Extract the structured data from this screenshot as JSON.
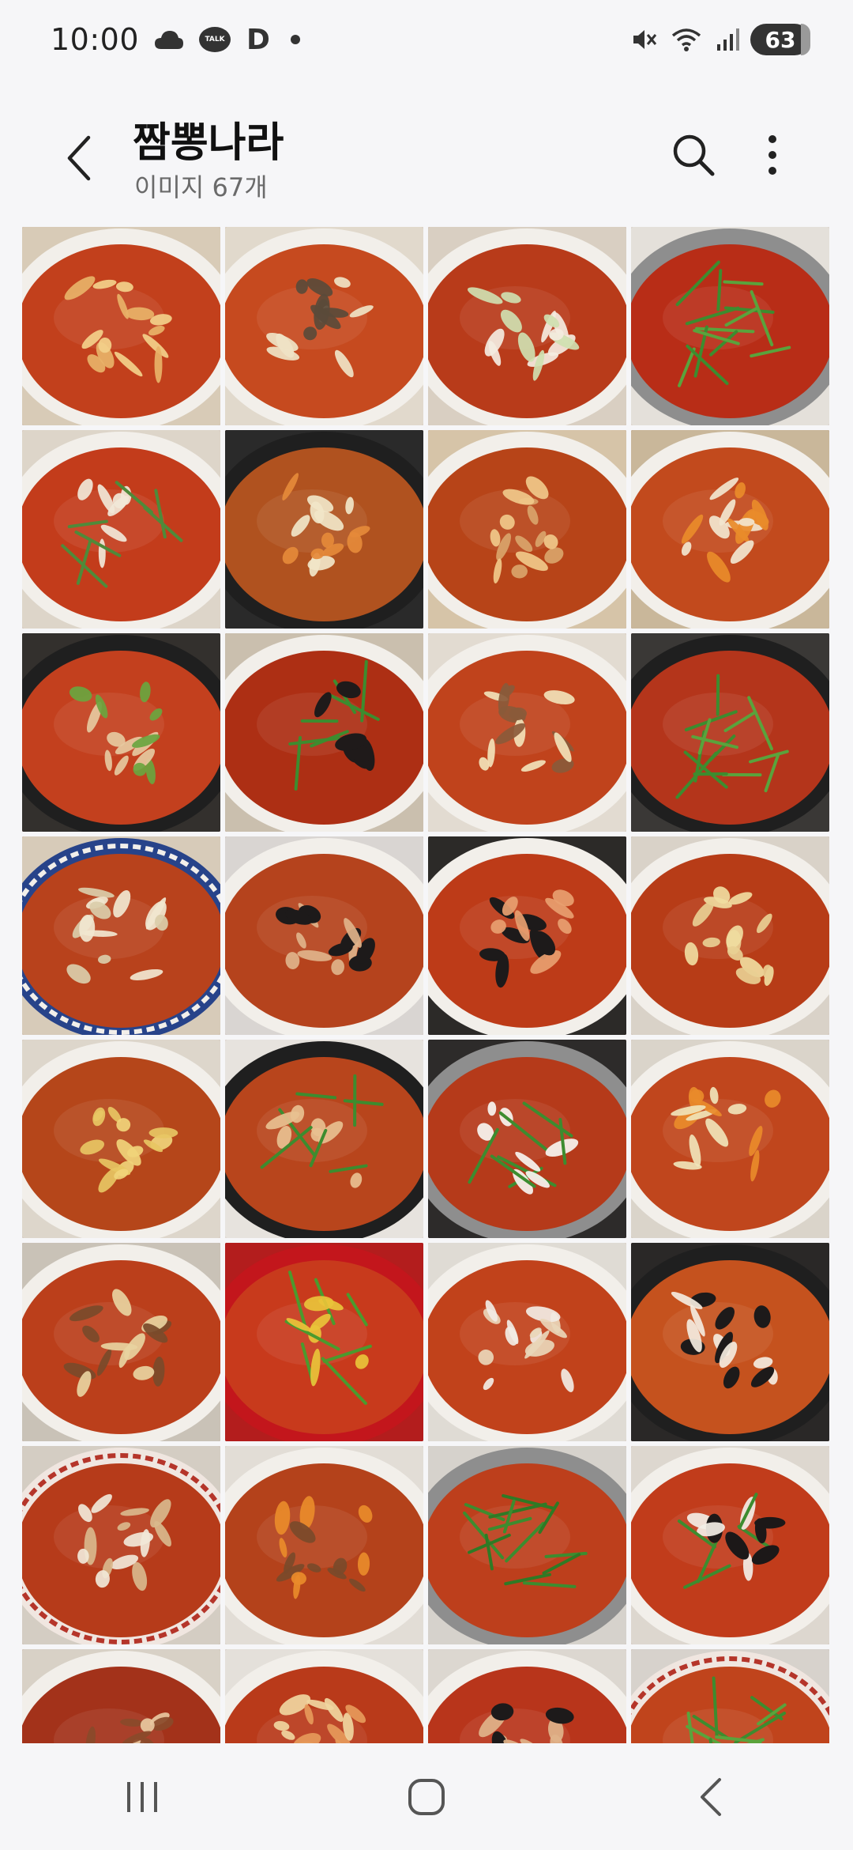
{
  "status_bar": {
    "time": "10:00",
    "talk_label": "TALK",
    "d_label": "D",
    "battery": "63",
    "icons": [
      "cloud-icon",
      "talk-icon",
      "d-icon",
      "dot-icon",
      "mute-icon",
      "wifi-icon",
      "signal-icon",
      "battery-icon"
    ]
  },
  "header": {
    "title": "짬뽕나라",
    "subtitle": "이미지 67개",
    "back_icon": "back-arrow-icon",
    "search_icon": "search-icon",
    "more_icon": "more-vertical-icon"
  },
  "gallery": {
    "thumbnails": [
      {
        "row": 1,
        "col": 1,
        "bowl": "white",
        "broth": "#c2401c",
        "topping": "egg-shrimp",
        "background": "#d8cbb7"
      },
      {
        "row": 1,
        "col": 2,
        "bowl": "white",
        "broth": "#c64a1f",
        "topping": "bamboo-mushroom",
        "background": "#e1d9cc"
      },
      {
        "row": 1,
        "col": 3,
        "bowl": "white",
        "broth": "#b83b1a",
        "topping": "squid-cabbage",
        "background": "#d9cfc2"
      },
      {
        "row": 1,
        "col": 4,
        "bowl": "metal",
        "broth": "#b82d17",
        "topping": "chives",
        "background": "#e4e0da"
      },
      {
        "row": 2,
        "col": 1,
        "bowl": "white",
        "broth": "#c33c1b",
        "topping": "squid-zucchini",
        "background": "#ddd5c9"
      },
      {
        "row": 2,
        "col": 2,
        "bowl": "black",
        "broth": "#b0521f",
        "topping": "onion",
        "background": "#2a2a2a"
      },
      {
        "row": 2,
        "col": 3,
        "bowl": "white",
        "broth": "#b74418",
        "topping": "shredded-pork",
        "background": "#d6c4a8"
      },
      {
        "row": 2,
        "col": 4,
        "bowl": "white",
        "broth": "#c24a1d",
        "topping": "carrot-onion",
        "background": "#c9b79a"
      },
      {
        "row": 3,
        "col": 1,
        "bowl": "black",
        "broth": "#c3401e",
        "topping": "chives-pork",
        "background": "#33302d"
      },
      {
        "row": 3,
        "col": 2,
        "bowl": "white",
        "broth": "#ad2f14",
        "topping": "chives-mussel",
        "background": "#cabfae"
      },
      {
        "row": 3,
        "col": 3,
        "bowl": "white",
        "broth": "#c0431c",
        "topping": "onion-pork",
        "background": "#e2dbd1"
      },
      {
        "row": 3,
        "col": 4,
        "bowl": "black",
        "broth": "#b4351b",
        "topping": "chives",
        "background": "#3a3836"
      },
      {
        "row": 4,
        "col": 1,
        "bowl": "blue",
        "broth": "#b8421c",
        "topping": "cabbage",
        "background": "#d7cbb9"
      },
      {
        "row": 4,
        "col": 2,
        "bowl": "white",
        "broth": "#b5431d",
        "topping": "mussels",
        "background": "#d9d5d2"
      },
      {
        "row": 4,
        "col": 3,
        "bowl": "white",
        "broth": "#bd3b18",
        "topping": "shrimp-mussel",
        "background": "#2c2a28"
      },
      {
        "row": 4,
        "col": 4,
        "bowl": "white",
        "broth": "#b73c17",
        "topping": "bean-sprouts",
        "background": "#d9d2c8"
      },
      {
        "row": 5,
        "col": 1,
        "bowl": "white",
        "broth": "#b5461a",
        "topping": "bamboo",
        "background": "#ddd6cb"
      },
      {
        "row": 5,
        "col": 2,
        "bowl": "black",
        "broth": "#b8451c",
        "topping": "table-set",
        "background": "#e7e3de"
      },
      {
        "row": 5,
        "col": 3,
        "bowl": "metal",
        "broth": "#b53a1a",
        "topping": "tofu",
        "background": "#2d2b2a"
      },
      {
        "row": 5,
        "col": 4,
        "bowl": "white",
        "broth": "#c0461d",
        "topping": "carrot-cabbage",
        "background": "#dad4ca"
      },
      {
        "row": 6,
        "col": 1,
        "bowl": "white",
        "broth": "#bb3f1b",
        "topping": "pork-bamboo",
        "background": "#c9c2b7"
      },
      {
        "row": 6,
        "col": 2,
        "bowl": "red",
        "broth": "#c83a1c",
        "topping": "green-chili",
        "background": "#b31d1d"
      },
      {
        "row": 6,
        "col": 3,
        "bowl": "white",
        "broth": "#c1421b",
        "topping": "crab",
        "background": "#dfdbd4"
      },
      {
        "row": 6,
        "col": 4,
        "bowl": "black",
        "broth": "#c5521e",
        "topping": "mussels-squid",
        "background": "#2a2827"
      },
      {
        "row": 7,
        "col": 1,
        "bowl": "patterned",
        "broth": "#b63b1a",
        "topping": "squid-onion",
        "background": "#d4cdc3"
      },
      {
        "row": 7,
        "col": 2,
        "bowl": "white",
        "broth": "#b4421b",
        "topping": "pork-carrot",
        "background": "#e2ddd6"
      },
      {
        "row": 7,
        "col": 3,
        "bowl": "metal",
        "broth": "#bd3f1c",
        "topping": "chives-big",
        "background": "#d6d2cc"
      },
      {
        "row": 7,
        "col": 4,
        "bowl": "white",
        "broth": "#c13c1b",
        "topping": "chives-mussel-squid",
        "background": "#ddd7cf"
      },
      {
        "row": 8,
        "col": 1,
        "bowl": "white",
        "broth": "#a3321a",
        "topping": "pork",
        "background": "#d8d1c6"
      },
      {
        "row": 8,
        "col": 2,
        "bowl": "white",
        "broth": "#b93a1a",
        "topping": "shredded",
        "background": "#e4e0da"
      },
      {
        "row": 8,
        "col": 3,
        "bowl": "white",
        "broth": "#b8351b",
        "topping": "mussels",
        "background": "#dcd7d0"
      },
      {
        "row": 8,
        "col": 4,
        "bowl": "patterned",
        "broth": "#c0441c",
        "topping": "chives",
        "background": "#d7d2cc"
      }
    ]
  },
  "nav_bar": {
    "icons": [
      "recent-apps-icon",
      "home-icon",
      "back-icon"
    ]
  }
}
